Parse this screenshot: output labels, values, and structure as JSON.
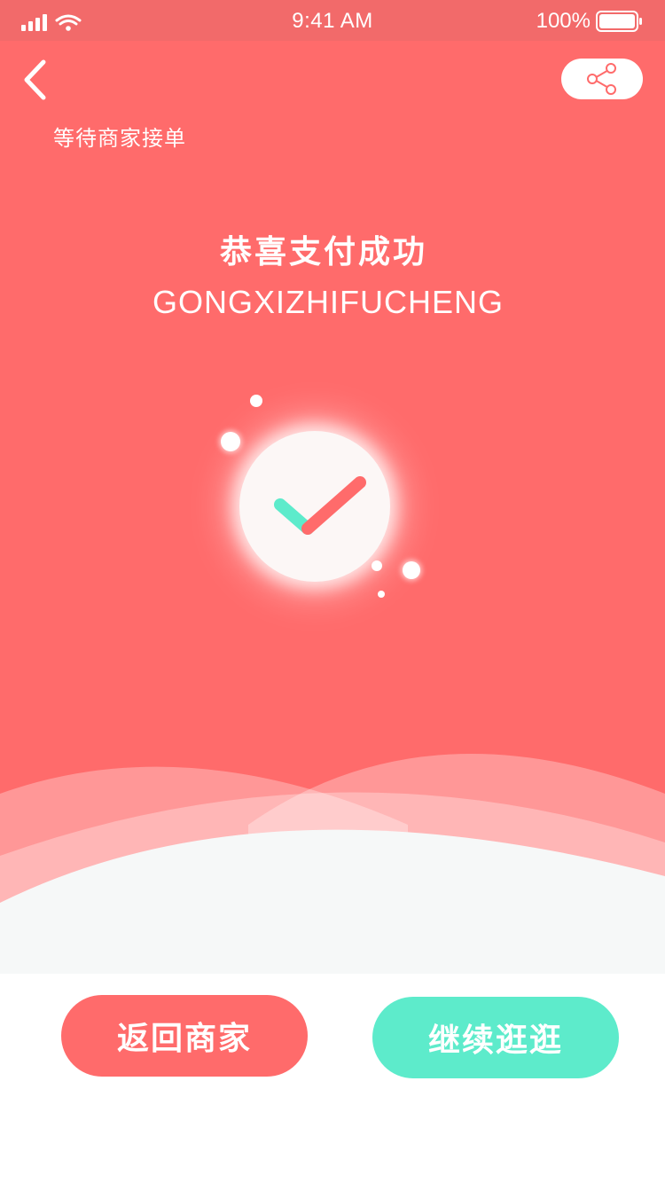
{
  "status_bar": {
    "time": "9:41 AM",
    "battery": "100%"
  },
  "header": {
    "back_icon": "chevron-left-icon",
    "share_icon": "share-icon",
    "order_status": "等待商家接单"
  },
  "result": {
    "title": "恭喜支付成功",
    "subtitle": "GONGXIZHIFUCHENG",
    "icon": "check-icon"
  },
  "actions": {
    "back_to_shop": "返回商家",
    "continue_shopping": "继续逛逛"
  },
  "colors": {
    "primary": "#FF6B6B",
    "accent": "#5DEBCB",
    "check_short": "#5DEBCB",
    "check_long": "#FF6B6B"
  }
}
